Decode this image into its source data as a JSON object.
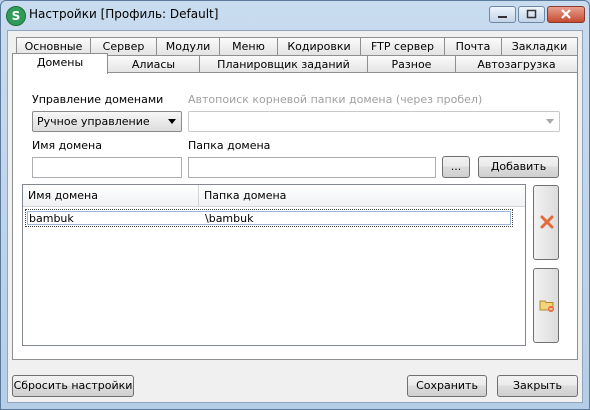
{
  "window": {
    "title": "Настройки [Профиль: Default]",
    "app_icon_letter": "S"
  },
  "tabs": {
    "row1": [
      "Основные",
      "Сервер",
      "Модули",
      "Меню",
      "Кодировки",
      "FTP сервер",
      "Почта",
      "Закладки"
    ],
    "row2": [
      "Домены",
      "Алиасы",
      "Планировщик заданий",
      "Разное",
      "Автозагрузка"
    ],
    "active": "Домены"
  },
  "domains": {
    "management_label": "Управление доменами",
    "management_value": "Ручное управление",
    "autosearch_label": "Автопоиск корневой папки домена (через пробел)",
    "autosearch_value": "",
    "domain_name_label": "Имя домена",
    "domain_name_value": "",
    "domain_folder_label": "Папка домена",
    "domain_folder_value": "",
    "browse_label": "...",
    "add_label": "Добавить",
    "table": {
      "columns": [
        "Имя домена",
        "Папка домена"
      ],
      "rows": [
        {
          "name": "bambuk",
          "folder": "\\bambuk"
        }
      ]
    }
  },
  "footer": {
    "reset_label": "Сбросить настройки",
    "save_label": "Сохранить",
    "close_label": "Закрыть"
  },
  "colors": {
    "delete_icon": "#e46a3a",
    "app_icon": "#2f9b59"
  }
}
